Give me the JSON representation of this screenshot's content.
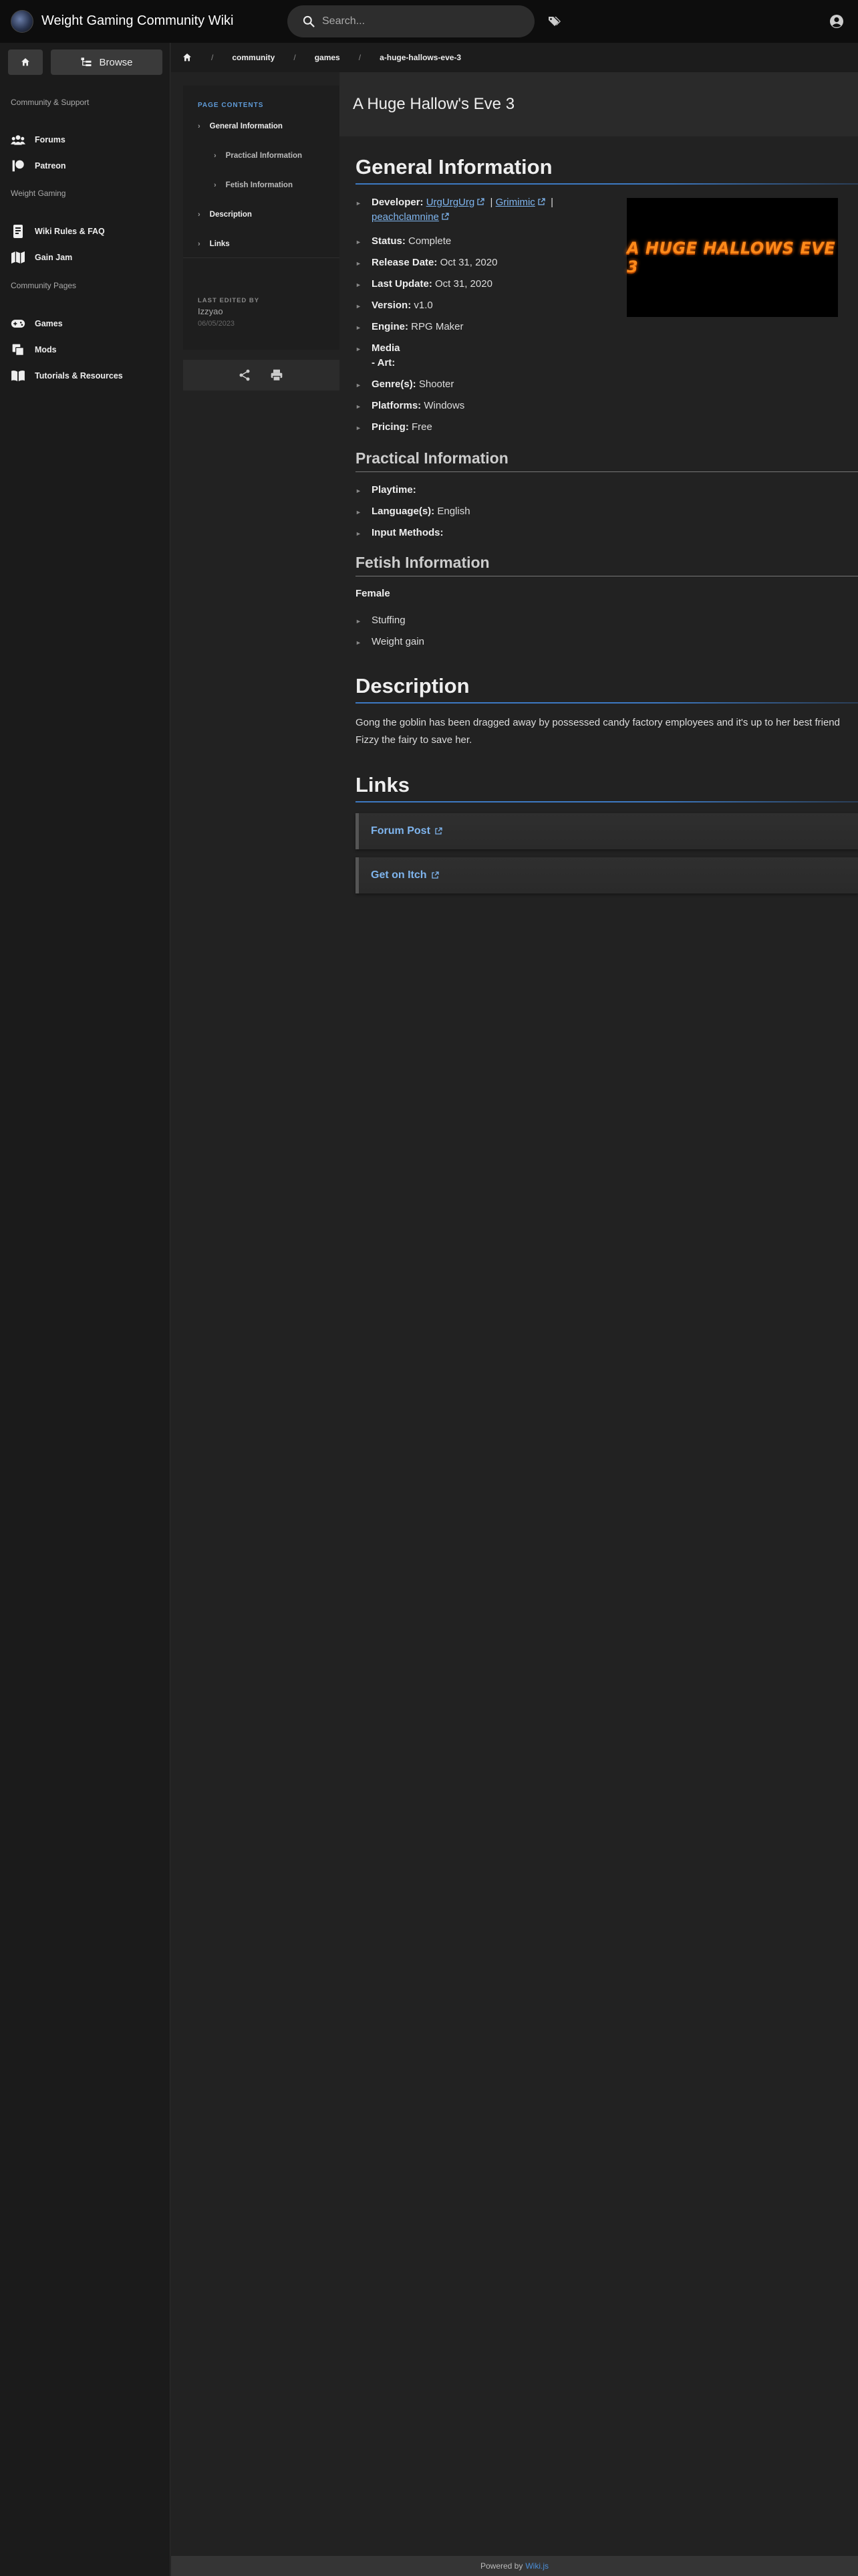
{
  "header": {
    "site_title": "Weight Gaming Community Wiki",
    "search_placeholder": "Search..."
  },
  "sidebar": {
    "browse_label": "Browse",
    "sections": [
      {
        "header": "Community & Support",
        "items": [
          {
            "label": "Forums",
            "icon": "users-icon"
          },
          {
            "label": "Patreon",
            "icon": "patreon-icon"
          }
        ]
      },
      {
        "header": "Weight Gaming",
        "items": [
          {
            "label": "Wiki Rules & FAQ",
            "icon": "document-icon"
          },
          {
            "label": "Gain Jam",
            "icon": "map-icon"
          }
        ]
      },
      {
        "header": "Community Pages",
        "items": [
          {
            "label": "Games",
            "icon": "gamepad-icon"
          },
          {
            "label": "Mods",
            "icon": "mods-icon"
          },
          {
            "label": "Tutorials & Resources",
            "icon": "book-icon"
          }
        ]
      }
    ]
  },
  "breadcrumb": [
    "community",
    "games",
    "a-huge-hallows-eve-3"
  ],
  "toc": {
    "title": "PAGE CONTENTS",
    "items": [
      "General Information",
      "Practical Information",
      "Fetish Information",
      "Description",
      "Links"
    ],
    "last_edited_label": "LAST EDITED BY",
    "last_edited_user": "Izzyao",
    "last_edited_date": "06/05/2023"
  },
  "page": {
    "title": "A Huge Hallow's Eve 3",
    "general": {
      "heading": "General Information",
      "developer_label": "Developer:",
      "developers": [
        "UrgUrgUrg",
        "Grimimic",
        "peachclamnine"
      ],
      "fields": [
        {
          "label": "Status:",
          "value": "Complete"
        },
        {
          "label": "Release Date:",
          "value": "Oct 31, 2020"
        },
        {
          "label": "Last Update:",
          "value": "Oct 31, 2020"
        },
        {
          "label": "Version:",
          "value": "v1.0"
        },
        {
          "label": "Engine:",
          "value": "RPG Maker"
        }
      ],
      "media_label": "Media",
      "media_sub": "- Art:",
      "fields2": [
        {
          "label": "Genre(s):",
          "value": "Shooter"
        },
        {
          "label": "Platforms:",
          "value": "Windows"
        },
        {
          "label": "Pricing:",
          "value": "Free"
        }
      ],
      "cover_text": "A HUGE HALLOWS EVE 3"
    },
    "practical": {
      "heading": "Practical Information",
      "playtime_label": "Playtime:",
      "language_label": "Language(s):",
      "language_value": "English",
      "input_label": "Input Methods:"
    },
    "fetish": {
      "heading": "Fetish Information",
      "subheading": "Female",
      "items": [
        "Stuffing",
        "Weight gain"
      ]
    },
    "description": {
      "heading": "Description",
      "text": "Gong the goblin has been dragged away by possessed candy factory employees and it's up to her best friend Fizzy the fairy to save her."
    },
    "links": {
      "heading": "Links",
      "items": [
        "Forum Post",
        "Get on Itch"
      ]
    }
  },
  "footer": {
    "prefix": "Powered by",
    "brand": "Wiki.js"
  }
}
